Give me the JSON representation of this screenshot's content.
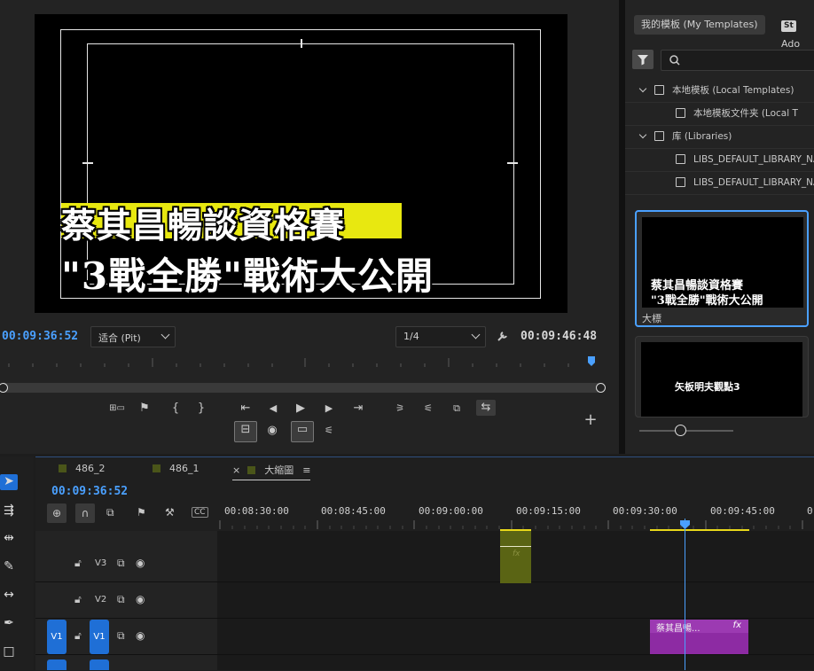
{
  "monitor": {
    "caption_line1": "蔡其昌暢談資格賽",
    "caption_line2": "\"3戰全勝\"戰術大公開",
    "timecode_current": "00:09:36:52",
    "zoom_label": "适合 (Pit)",
    "resolution_label": "1/4",
    "timecode_duration": "00:09:46:48",
    "controls": {
      "add_marker": "⚑",
      "mark_in": "{",
      "mark_out": "}",
      "go_to_in": "⇤",
      "step_back": "◀",
      "play": "▶",
      "step_forward": "▶",
      "go_to_out": "⇥",
      "add": "+"
    }
  },
  "essential_graphics": {
    "tabs": [
      "我的模板 (My Templates)",
      "Ado"
    ],
    "stock_badge": "St",
    "search_placeholder": "",
    "tree": [
      {
        "label": "本地模板 (Local Templates)",
        "level": 0,
        "expanded": true
      },
      {
        "label": "本地模板文件夹 (Local T",
        "level": 1
      },
      {
        "label": "库 (Libraries)",
        "level": 0,
        "expanded": true
      },
      {
        "label": "LIBS_DEFAULT_LIBRARY_NA",
        "level": 1
      },
      {
        "label": "LIBS_DEFAULT_LIBRARY_NA",
        "level": 1
      }
    ],
    "templates": [
      {
        "name": "大標",
        "preview_line1": "蔡其昌暢談資格賽",
        "preview_line2": "\"3戰全勝\"戰術大公開"
      },
      {
        "name": "",
        "preview_line1": "矢板明夫觀點3",
        "preview_line2": ""
      }
    ]
  },
  "timeline": {
    "tabs": [
      "486_2",
      "486_1",
      "大縮圖"
    ],
    "active_tab_close": "×",
    "active_tab_menu": "≡",
    "current_timecode": "00:09:36:52",
    "ruler_labels": [
      "00:08:30:00",
      "00:08:45:00",
      "00:09:00:00",
      "00:09:15:00",
      "00:09:30:00",
      "00:09:45:00",
      "0"
    ],
    "tracks": [
      {
        "name": "V3",
        "source": ""
      },
      {
        "name": "V2",
        "source": ""
      },
      {
        "name": "V1",
        "source": "V1"
      }
    ],
    "clips": {
      "v3_fx": "fx",
      "v1_title": "蔡其昌暢...",
      "v1_fx": "fx"
    }
  },
  "colors": {
    "accent_blue": "#4aa0ff",
    "clip_olive": "#5a6414",
    "clip_purple": "#8d2ba3",
    "caption_highlight": "#e8e810"
  }
}
